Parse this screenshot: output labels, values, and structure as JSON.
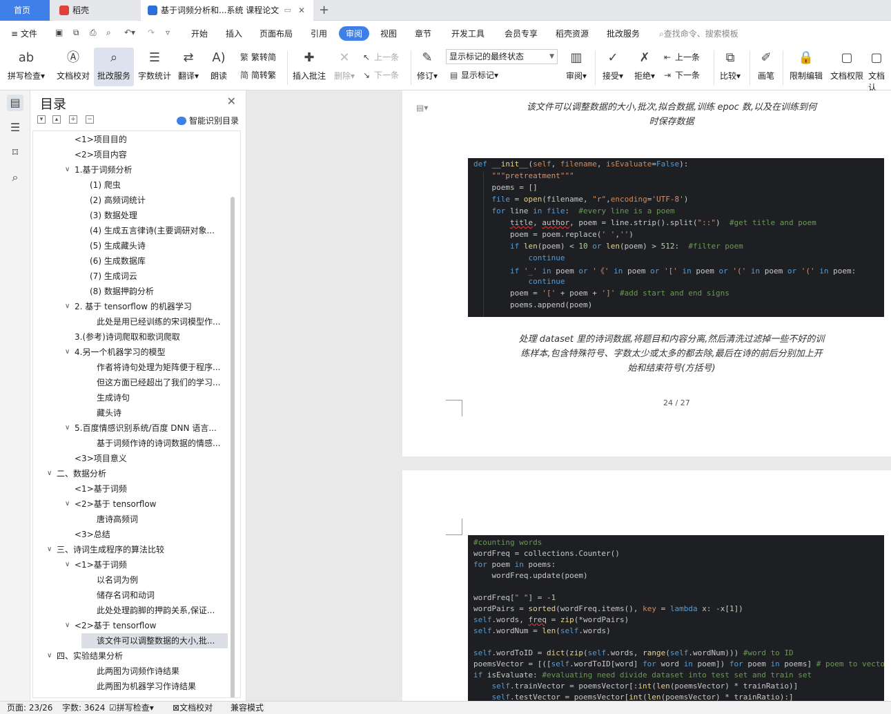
{
  "tabs": {
    "home": "首页",
    "daoke": "稻壳",
    "doc": "基于词频分析和...系统 课程论文",
    "close": "✕",
    "add": "+"
  },
  "colors": {
    "accent": "#3f7fe8",
    "daoke_red": "#e0403a",
    "doc_blue": "#2f6fdc"
  },
  "menu": {
    "file": "文件",
    "items": [
      "开始",
      "插入",
      "页面布局",
      "引用",
      "审阅",
      "视图",
      "章节",
      "开发工具",
      "会员专享",
      "稻壳资源",
      "批改服务"
    ],
    "active": "审阅",
    "search": "查找命令、搜索模板"
  },
  "ribbon": {
    "spell": "拼写检查",
    "proof": "文档校对",
    "grade": "批改服务",
    "wordcount": "字数统计",
    "translate": "翻译",
    "read": "朗读",
    "to_trad": "繁转简",
    "to_simp": "简转繁",
    "insert_comment": "插入批注",
    "delete": "删除",
    "prev": "上一条",
    "next": "下一条",
    "revise": "修订",
    "markup_select": "显示标记的最终状态",
    "show_markup": "显示标记",
    "review": "审阅",
    "accept": "接受",
    "reject": "拒绝",
    "prev2": "上一条",
    "next2": "下一条",
    "compare": "比较",
    "pen": "画笔",
    "restrict": "限制编辑",
    "doc_rights": "文档权限",
    "doc_more": "文档认"
  },
  "toc": {
    "title": "目录",
    "smart": "智能识别目录",
    "items": [
      {
        "text": "<1>项目目的",
        "level": 2,
        "arrow": ""
      },
      {
        "text": "<2>项目内容",
        "level": 2,
        "arrow": ""
      },
      {
        "text": "1.基于词频分析",
        "level": 2,
        "arrow": "v"
      },
      {
        "text": "(1) 爬虫",
        "level": 3,
        "arrow": ""
      },
      {
        "text": "(2) 高频词统计",
        "level": 3,
        "arrow": ""
      },
      {
        "text": "(3) 数据处理",
        "level": 3,
        "arrow": ""
      },
      {
        "text": "(4) 生成五言律诗(主要调研对象...",
        "level": 3,
        "arrow": ""
      },
      {
        "text": "(5) 生成藏头诗",
        "level": 3,
        "arrow": ""
      },
      {
        "text": "(6) 生成数据库",
        "level": 3,
        "arrow": ""
      },
      {
        "text": "(7) 生成词云",
        "level": 3,
        "arrow": ""
      },
      {
        "text": "(8) 数据押韵分析",
        "level": 3,
        "arrow": ""
      },
      {
        "text": "2. 基于 tensorflow 的机器学习",
        "level": 2,
        "arrow": "v"
      },
      {
        "text": "此处是用已经训练的宋词模型作...",
        "level": 4,
        "arrow": ""
      },
      {
        "text": "3.(参考)诗词爬取和歌词爬取",
        "level": 2,
        "arrow": ""
      },
      {
        "text": "4.另一个机器学习的模型",
        "level": 2,
        "arrow": "v"
      },
      {
        "text": "作者将诗句处理为矩阵便于程序...",
        "level": 4,
        "arrow": ""
      },
      {
        "text": "但这方面已经超出了我们的学习...",
        "level": 4,
        "arrow": ""
      },
      {
        "text": "生成诗句",
        "level": 4,
        "arrow": ""
      },
      {
        "text": "藏头诗",
        "level": 4,
        "arrow": ""
      },
      {
        "text": "5.百度情感识别系统/百度 DNN 语言...",
        "level": 2,
        "arrow": "v"
      },
      {
        "text": "基于词频作诗的诗词数据的情感...",
        "level": 4,
        "arrow": ""
      },
      {
        "text": "<3>项目意义",
        "level": 2,
        "arrow": ""
      },
      {
        "text": "二、数据分析",
        "level": 1,
        "arrow": "v"
      },
      {
        "text": "<1>基于词频",
        "level": 2,
        "arrow": ""
      },
      {
        "text": "<2>基于 tensorflow",
        "level": 2,
        "arrow": "v"
      },
      {
        "text": "唐诗高频词",
        "level": 4,
        "arrow": ""
      },
      {
        "text": "<3>总结",
        "level": 2,
        "arrow": ""
      },
      {
        "text": "三、诗词生成程序的算法比较",
        "level": 1,
        "arrow": "v"
      },
      {
        "text": "<1>基于词频",
        "level": 2,
        "arrow": "v"
      },
      {
        "text": "以名词为例",
        "level": 4,
        "arrow": ""
      },
      {
        "text": "储存名词和动词",
        "level": 4,
        "arrow": ""
      },
      {
        "text": "此处处理韵脚的押韵关系,保证...",
        "level": 4,
        "arrow": ""
      },
      {
        "text": "<2>基于 tensorflow",
        "level": 2,
        "arrow": "v"
      },
      {
        "text": "该文件可以调整数据的大小,批...",
        "level": 4,
        "arrow": "",
        "selected": true
      },
      {
        "text": "四、实验结果分析",
        "level": 1,
        "arrow": "v"
      },
      {
        "text": "此两图为词频作诗结果",
        "level": 4,
        "arrow": ""
      },
      {
        "text": "此两图为机器学习作诗结果",
        "level": 4,
        "arrow": ""
      }
    ]
  },
  "doc": {
    "caption1_line1": "该文件可以调整数据的大小,批次,拟合数据,训练 epoc 数,以及在训练到何",
    "caption1_line2": "时保存数据",
    "caption2_line1": "处理 dataset 里的诗词数据,将题目和内容分离,然后清洗过滤掉一些不好的训",
    "caption2_line2": "练样本,包含特殊符号、字数太少或太多的都去除,最后在诗的前后分别加上开",
    "caption2_line3": "始和结束符号(方括号)",
    "page_num": "24 / 27"
  },
  "status": {
    "page": "页面: 23/26",
    "words": "字数: 3624",
    "spell": "拼写检查",
    "proof": "文档校对",
    "compat": "兼容模式"
  }
}
